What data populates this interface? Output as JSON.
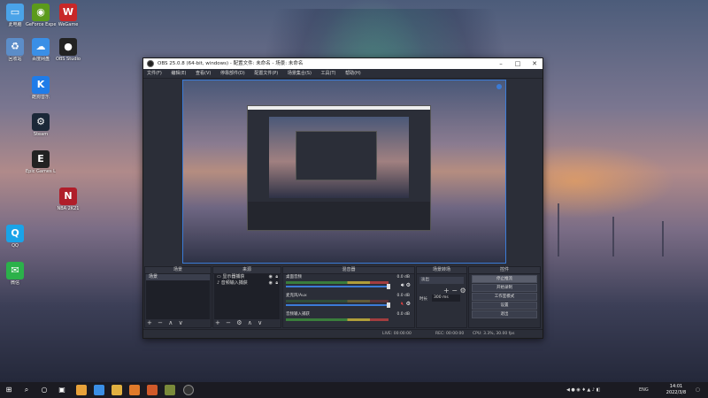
{
  "obs": {
    "title": "OBS 25.0.8 (64-bit, windows) - 配置文件: 未命名 - 场景: 未命名",
    "menu": [
      "文件(F)",
      "编辑(E)",
      "查看(V)",
      "停靠部件(D)",
      "配置文件(P)",
      "场景集合(S)",
      "工具(T)",
      "帮助(H)"
    ],
    "docks": {
      "scenes_title": "场景",
      "sources_title": "来源",
      "mixer_title": "混音器",
      "transitions_title": "场景转场",
      "controls_title": "控件"
    },
    "scenes": [
      "场景"
    ],
    "sources": [
      {
        "name": "显示器捕获",
        "icon": "monitor-icon"
      },
      {
        "name": "音频输入捕获",
        "icon": "mic-icon"
      }
    ],
    "mixer": [
      {
        "name": "桌面音频",
        "db": "0.0 dB",
        "muted": false
      },
      {
        "name": "麦克风/Aux",
        "db": "0.0 dB",
        "muted": true
      },
      {
        "name": "音频输入捕获",
        "db": "0.0 dB",
        "muted": false
      }
    ],
    "transitions": {
      "type": "淡出",
      "duration_label": "时长",
      "duration_value": "300 ms"
    },
    "controls": [
      "停止推流",
      "开始录制",
      "工作室模式",
      "设置",
      "退出"
    ],
    "status": {
      "live": "LIVE: 00:00:00",
      "rec": "REC: 00:00:00",
      "cpu": "CPU: 3.3%, 30.00 fps"
    }
  },
  "taskbar": {
    "time": "14:01",
    "date": "2022/3/8",
    "lang": "ENG"
  },
  "desktop_icons": [
    {
      "label": "此电脑",
      "icon": "computer-icon",
      "color": "#4aa3e8"
    },
    {
      "label": "GeForce Experience",
      "icon": "nvidia-icon",
      "color": "#5b9a1b"
    },
    {
      "label": "WeGame",
      "icon": "wegame-icon",
      "color": "#c82828"
    },
    {
      "label": "回收站",
      "icon": "recycle-bin-icon",
      "color": "#5c8dc8"
    },
    {
      "label": "百度网盘",
      "icon": "baidu-netdisk-icon",
      "color": "#3a8fe6"
    },
    {
      "label": "OBS Studio",
      "icon": "obs-icon",
      "color": "#222222"
    },
    {
      "label": "酷狗音乐",
      "icon": "kugou-icon",
      "color": "#1f7ce8"
    },
    {
      "label": "Steam",
      "icon": "steam-icon",
      "color": "#1b2838"
    },
    {
      "label": "Epic Games Launcher",
      "icon": "epic-icon",
      "color": "#222222"
    },
    {
      "label": "QQ",
      "icon": "qq-icon",
      "color": "#1aa3e8"
    },
    {
      "label": "微信",
      "icon": "wechat-icon",
      "color": "#2bb14a"
    },
    {
      "label": "NBA 2K21",
      "icon": "nba-icon",
      "color": "#b01e2a"
    }
  ]
}
